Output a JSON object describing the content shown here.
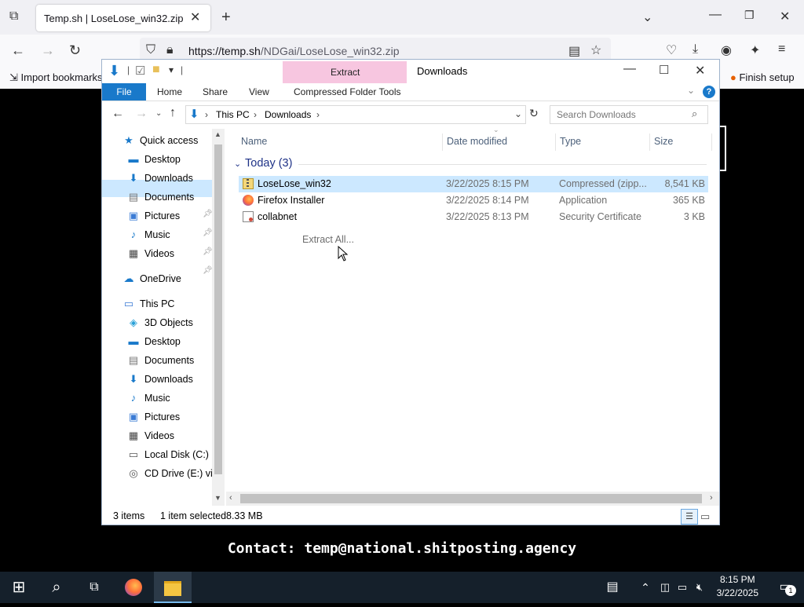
{
  "browser": {
    "tab_title": "Temp.sh | LoseLose_win32.zip",
    "url_host": "https://temp.sh",
    "url_path": "/NDGai/LoseLose_win32.zip",
    "bookmark_import": "Import bookmarks",
    "finish_setup": "Finish setup"
  },
  "page": {
    "contact": "Contact: temp@national.shitposting.agency"
  },
  "explorer": {
    "title": "Downloads",
    "contextual_tab": "Extract",
    "ribbon_tabs": [
      "File",
      "Home",
      "Share",
      "View",
      "Compressed Folder Tools"
    ],
    "breadcrumb": [
      "This PC",
      "Downloads"
    ],
    "search_placeholder": "Search Downloads",
    "columns": [
      "Name",
      "Date modified",
      "Type",
      "Size"
    ],
    "group_label": "Today (3)",
    "files": [
      {
        "name": "LoseLose_win32",
        "date": "3/22/2025 8:15 PM",
        "type": "Compressed (zipp...",
        "size": "8,541 KB",
        "icon": "zip-folder-icon"
      },
      {
        "name": "Firefox Installer",
        "date": "3/22/2025 8:14 PM",
        "type": "Application",
        "size": "365 KB",
        "icon": "firefox-icon"
      },
      {
        "name": "collabnet",
        "date": "3/22/2025 8:13 PM",
        "type": "Security Certificate",
        "size": "3 KB",
        "icon": "certificate-icon"
      }
    ],
    "context_hint": "Extract All...",
    "nav": {
      "quick_access": "Quick access",
      "qa_items": [
        "Desktop",
        "Downloads",
        "Documents",
        "Pictures",
        "Music",
        "Videos"
      ],
      "onedrive": "OneDrive",
      "this_pc": "This PC",
      "pc_items": [
        "3D Objects",
        "Desktop",
        "Documents",
        "Downloads",
        "Music",
        "Pictures",
        "Videos",
        "Local Disk (C:)",
        "CD Drive (E:) virt"
      ]
    },
    "status": {
      "items": "3 items",
      "selected": "1 item selected",
      "size": "8.33 MB"
    }
  },
  "taskbar": {
    "time": "8:15 PM",
    "date": "3/22/2025",
    "notification_count": "1"
  },
  "colors": {
    "selection": "#cce8ff",
    "file_tab": "#1979ca",
    "context_tab": "#f7c6e0",
    "taskbar": "#15202b"
  }
}
